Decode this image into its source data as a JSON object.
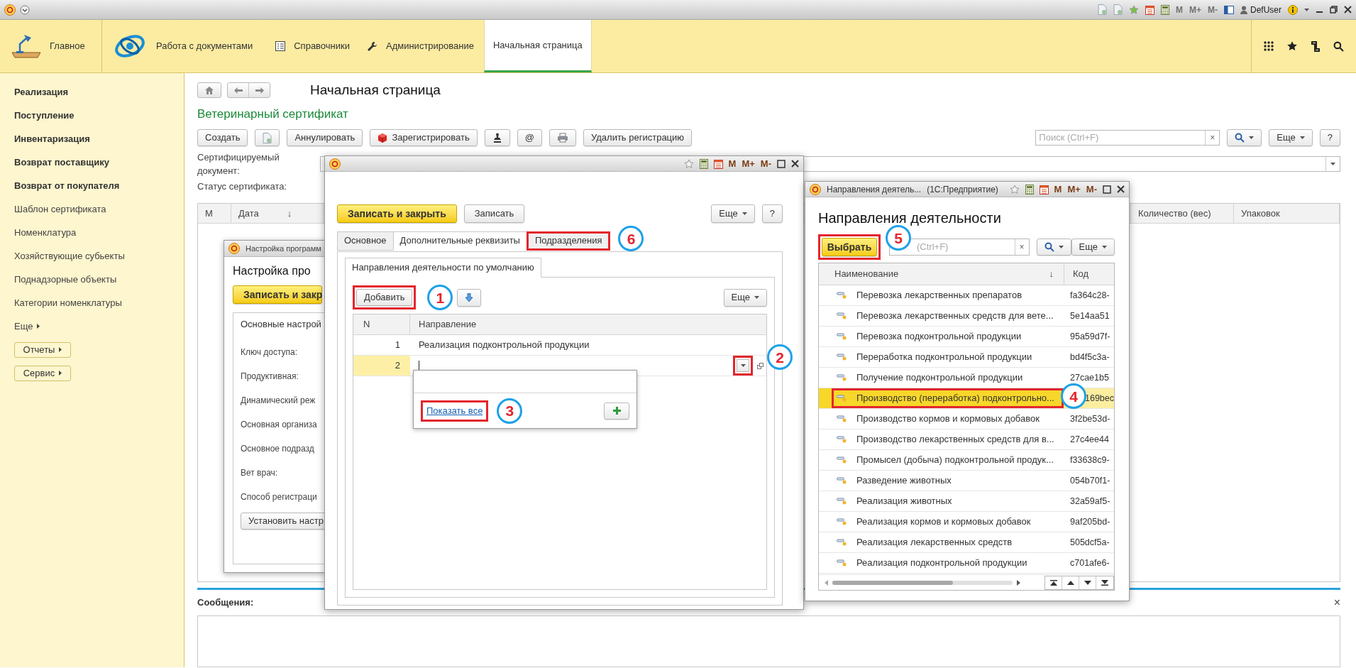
{
  "title_bar": {
    "memory": [
      "M",
      "M+",
      "M-"
    ],
    "user": "DefUser"
  },
  "nav": {
    "items": [
      {
        "label": "Главное",
        "kind": "home",
        "selected": false
      },
      {
        "label": "Работа с документами",
        "kind": "docs",
        "selected": false
      },
      {
        "label": "Справочники",
        "kind": "catalogs",
        "selected": false
      },
      {
        "label": "Администрирование",
        "kind": "admin",
        "selected": false
      },
      {
        "label": "Начальная страница",
        "kind": "tab",
        "selected": true
      }
    ]
  },
  "sidebar": {
    "items": [
      {
        "label": "Реализация",
        "bold": true
      },
      {
        "label": "Поступление",
        "bold": true
      },
      {
        "label": "Инвентаризация",
        "bold": true
      },
      {
        "label": "Возврат поставщику",
        "bold": true
      },
      {
        "label": "Возврат от покупателя",
        "bold": true
      },
      {
        "label": "Шаблон сертификата",
        "bold": false
      },
      {
        "label": "Номенклатура",
        "bold": false
      },
      {
        "label": "Хозяйствующие субьекты",
        "bold": false
      },
      {
        "label": "Поднадзорные объекты",
        "bold": false
      },
      {
        "label": "Категории номенклатуры",
        "bold": false
      }
    ],
    "more": "Еще",
    "buttons": [
      "Отчеты",
      "Сервис"
    ]
  },
  "main": {
    "title": "Начальная страница",
    "form_title": "Ветеринарный сертификат",
    "toolbar": [
      {
        "kind": "text",
        "label": "Создать"
      },
      {
        "kind": "document"
      },
      {
        "kind": "text",
        "label": "Аннулировать"
      },
      {
        "kind": "register",
        "label": "Зарегистрировать"
      },
      {
        "kind": "stamp"
      },
      {
        "kind": "text",
        "label": "@"
      },
      {
        "kind": "printer"
      },
      {
        "kind": "text",
        "label": "Удалить регистрацию"
      }
    ],
    "search": {
      "placeholder": "Поиск (Ctrl+F)",
      "clear": "×"
    },
    "more": "Еще",
    "help": "?",
    "fields": [
      {
        "label": "Сертифицируемый документ:"
      },
      {
        "label": "Статус сертификата:"
      }
    ],
    "table": {
      "columns": [
        {
          "label": "М"
        },
        {
          "label": "Дата",
          "sort": "↓"
        },
        {
          "label": "Количество (вес)"
        },
        {
          "label": "Упаковок"
        }
      ]
    }
  },
  "messages": {
    "title": "Сообщения:",
    "close": "×"
  },
  "settings_window": {
    "title": "Настройка программ",
    "heading": "Настройка про",
    "save": "Записать и закр",
    "tab": "Основные настрой",
    "fields": [
      "Ключ доступа:",
      "Продуктивная:",
      "Динамический реж",
      "Основная организа",
      "Основное подразд",
      "Вет врач:",
      "Способ регистраци"
    ],
    "button": "Установить настр"
  },
  "edit_window": {
    "memory": [
      "M",
      "M+",
      "M-"
    ],
    "save_close": "Записать и закрыть",
    "save": "Записать",
    "more": "Еще",
    "help": "?",
    "tabs": [
      {
        "label": "Основное",
        "selected": false,
        "highlighted": false
      },
      {
        "label": "Дополнительные реквизиты",
        "selected": true,
        "highlighted": false
      },
      {
        "label": "Подразделения",
        "selected": false,
        "highlighted": true,
        "marker": "6"
      }
    ],
    "subtab": "Направления деятельности по умолчанию",
    "add": {
      "label": "Добавить",
      "highlighted": true,
      "marker": "1"
    },
    "more2": "Еще",
    "columns": [
      "N",
      "Направление"
    ],
    "rows": [
      {
        "n": "1",
        "value": "Реализация подконтрольной продукции",
        "selected": false
      },
      {
        "n": "2",
        "selected": true
      }
    ],
    "dropdown_button": {
      "highlighted": true,
      "marker": "2"
    },
    "popup": {
      "link": "Показать все",
      "highlighted": true,
      "marker": "3"
    }
  },
  "list_window": {
    "title": "Направления деятель...",
    "app": "(1С:Предприятие)",
    "memory": [
      "M",
      "M+",
      "M-"
    ],
    "heading": "Направления деятельности",
    "select": {
      "label": "Выбрать",
      "highlighted": true,
      "marker": "5"
    },
    "search": {
      "placeholder": "(Ctrl+F)",
      "clear": "×"
    },
    "more": "Еще",
    "columns": [
      {
        "label": "Наименование",
        "sort": "↓"
      },
      {
        "label": "Код"
      }
    ],
    "rows": [
      {
        "name": "Перевозка лекарственных препаратов",
        "code": "fa364c28-",
        "selected": false,
        "highlighted": false
      },
      {
        "name": "Перевозка лекарственных средств для вете...",
        "code": "5e14aa51",
        "selected": false,
        "highlighted": false
      },
      {
        "name": "Перевозка подконтрольной продукции",
        "code": "95a59d7f-",
        "selected": false,
        "highlighted": false
      },
      {
        "name": "Переработка подконтрольной продукции",
        "code": "bd4f5c3a-",
        "selected": false,
        "highlighted": false
      },
      {
        "name": "Получение подконтрольной продукции",
        "code": "27cae1b5",
        "selected": false,
        "highlighted": false
      },
      {
        "name": "Производство (переработка) подконтрольно...",
        "code": "169bec",
        "selected": true,
        "highlighted": true,
        "marker": "4"
      },
      {
        "name": "Производство кормов и кормовых добавок",
        "code": "3f2be53d-",
        "selected": false,
        "highlighted": false
      },
      {
        "name": "Производство лекарственных средств для в...",
        "code": "27c4ee44",
        "selected": false,
        "highlighted": false
      },
      {
        "name": "Промысел (добыча) подконтрольной продук...",
        "code": "f33638c9-",
        "selected": false,
        "highlighted": false
      },
      {
        "name": "Разведение животных",
        "code": "054b70f1-",
        "selected": false,
        "highlighted": false
      },
      {
        "name": "Реализация животных",
        "code": "32a59af5-",
        "selected": false,
        "highlighted": false
      },
      {
        "name": "Реализация кормов и кормовых добавок",
        "code": "9af205bd-",
        "selected": false,
        "highlighted": false
      },
      {
        "name": "Реализация лекарственных средств",
        "code": "505dcf5a-",
        "selected": false,
        "highlighted": false
      },
      {
        "name": "Реализация подконтрольной продукции",
        "code": "c701afe6-",
        "selected": false,
        "highlighted": false
      }
    ]
  }
}
